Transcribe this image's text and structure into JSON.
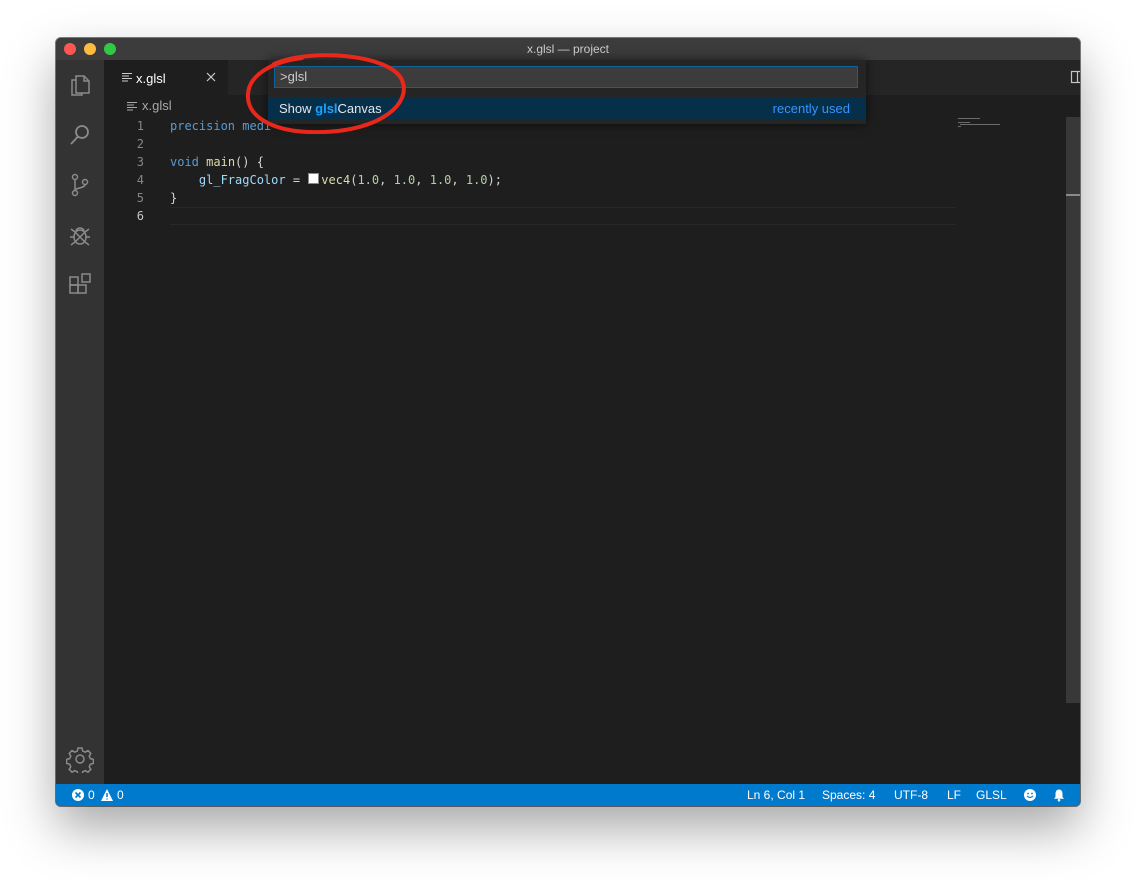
{
  "window": {
    "title": "x.glsl — project"
  },
  "activitybar": {
    "items": [
      "explorer-icon",
      "search-icon",
      "source-control-icon",
      "debug-icon",
      "extensions-icon"
    ],
    "bottom": "gear-icon"
  },
  "tabs": [
    {
      "label": "x.glsl",
      "icon": "file-lines-icon",
      "close_icon": "close-icon"
    }
  ],
  "breadcrumb": {
    "label": "x.glsl",
    "icon": "file-lines-icon"
  },
  "editor": {
    "line_numbers": [
      "1",
      "2",
      "3",
      "4",
      "5",
      "6"
    ],
    "active_line": 6,
    "lines": {
      "l1": {
        "kw": "precision medi",
        "rest": ""
      },
      "l3": {
        "kw": "void",
        "fn": "main",
        "rest": "() {"
      },
      "l4": {
        "indent": "    ",
        "var": "gl_FragColor",
        "op": " = ",
        "fn": "vec4",
        "p1": "(",
        "n1": "1.0",
        "c1": ", ",
        "n2": "1.0",
        "c2": ", ",
        "n3": "1.0",
        "c3": ", ",
        "n4": "1.0",
        "end": ");"
      },
      "l5": {
        "text": "}"
      }
    },
    "color_swatch": "#ffffff"
  },
  "command_palette": {
    "input_value": ">glsl",
    "items": [
      {
        "prefix": "Show ",
        "highlight": "glsl",
        "suffix": "Canvas",
        "meta": "recently used"
      }
    ]
  },
  "annotation": {
    "color": "#e8281b",
    "shape": "ellipse"
  },
  "statusbar": {
    "errors": "0",
    "warnings": "0",
    "position": "Ln 6, Col 1",
    "spaces": "Spaces: 4",
    "encoding": "UTF-8",
    "eol": "LF",
    "language": "GLSL",
    "feedback_icon": "smiley-icon",
    "notifications_icon": "bell-icon",
    "background": "#007acc"
  }
}
